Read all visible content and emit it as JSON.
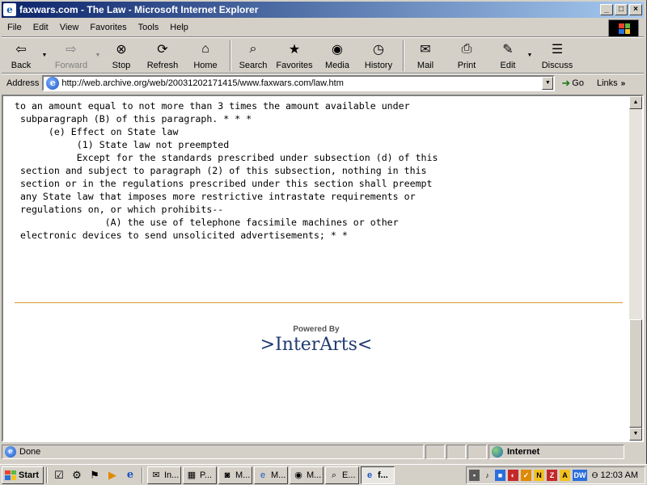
{
  "window": {
    "title": "faxwars.com - The Law - Microsoft Internet Explorer",
    "app_icon_glyph": "e"
  },
  "menu": {
    "items": [
      "File",
      "Edit",
      "View",
      "Favorites",
      "Tools",
      "Help"
    ]
  },
  "toolbar": {
    "back": "Back",
    "forward": "Forward",
    "stop": "Stop",
    "refresh": "Refresh",
    "home": "Home",
    "search": "Search",
    "favorites": "Favorites",
    "media": "Media",
    "history": "History",
    "mail": "Mail",
    "print": "Print",
    "edit": "Edit",
    "discuss": "Discuss"
  },
  "address": {
    "label": "Address",
    "url": "http://web.archive.org/web/20031202171415/www.faxwars.com/law.htm",
    "go": "Go",
    "links": "Links"
  },
  "content": {
    "lines": [
      "to an amount equal to not more than 3 times the amount available under",
      " subparagraph (B) of this paragraph. * * *",
      "      (e) Effect on State law",
      "           (1) State law not preempted",
      "           Except for the standards prescribed under subsection (d) of this",
      " section and subject to paragraph (2) of this subsection, nothing in this",
      " section or in the regulations prescribed under this section shall preempt",
      " any State law that imposes more restrictive intrastate requirements or",
      " regulations on, or which prohibits--",
      "                (A) the use of telephone facsimile machines or other",
      " electronic devices to send unsolicited advertisements; * *"
    ],
    "powered_by": "Powered By",
    "brand": ">InterArts<"
  },
  "status": {
    "text": "Done",
    "zone": "Internet"
  },
  "taskbar": {
    "start": "Start",
    "tasks": [
      "In...",
      "P...",
      "M...",
      "M...",
      "M...",
      "E...",
      "f..."
    ],
    "clock": "12:03 AM"
  },
  "colors": {
    "titlebar_start": "#0a246a",
    "titlebar_end": "#a6caf0",
    "divider": "#d89a2a",
    "brand": "#1f3a70"
  }
}
